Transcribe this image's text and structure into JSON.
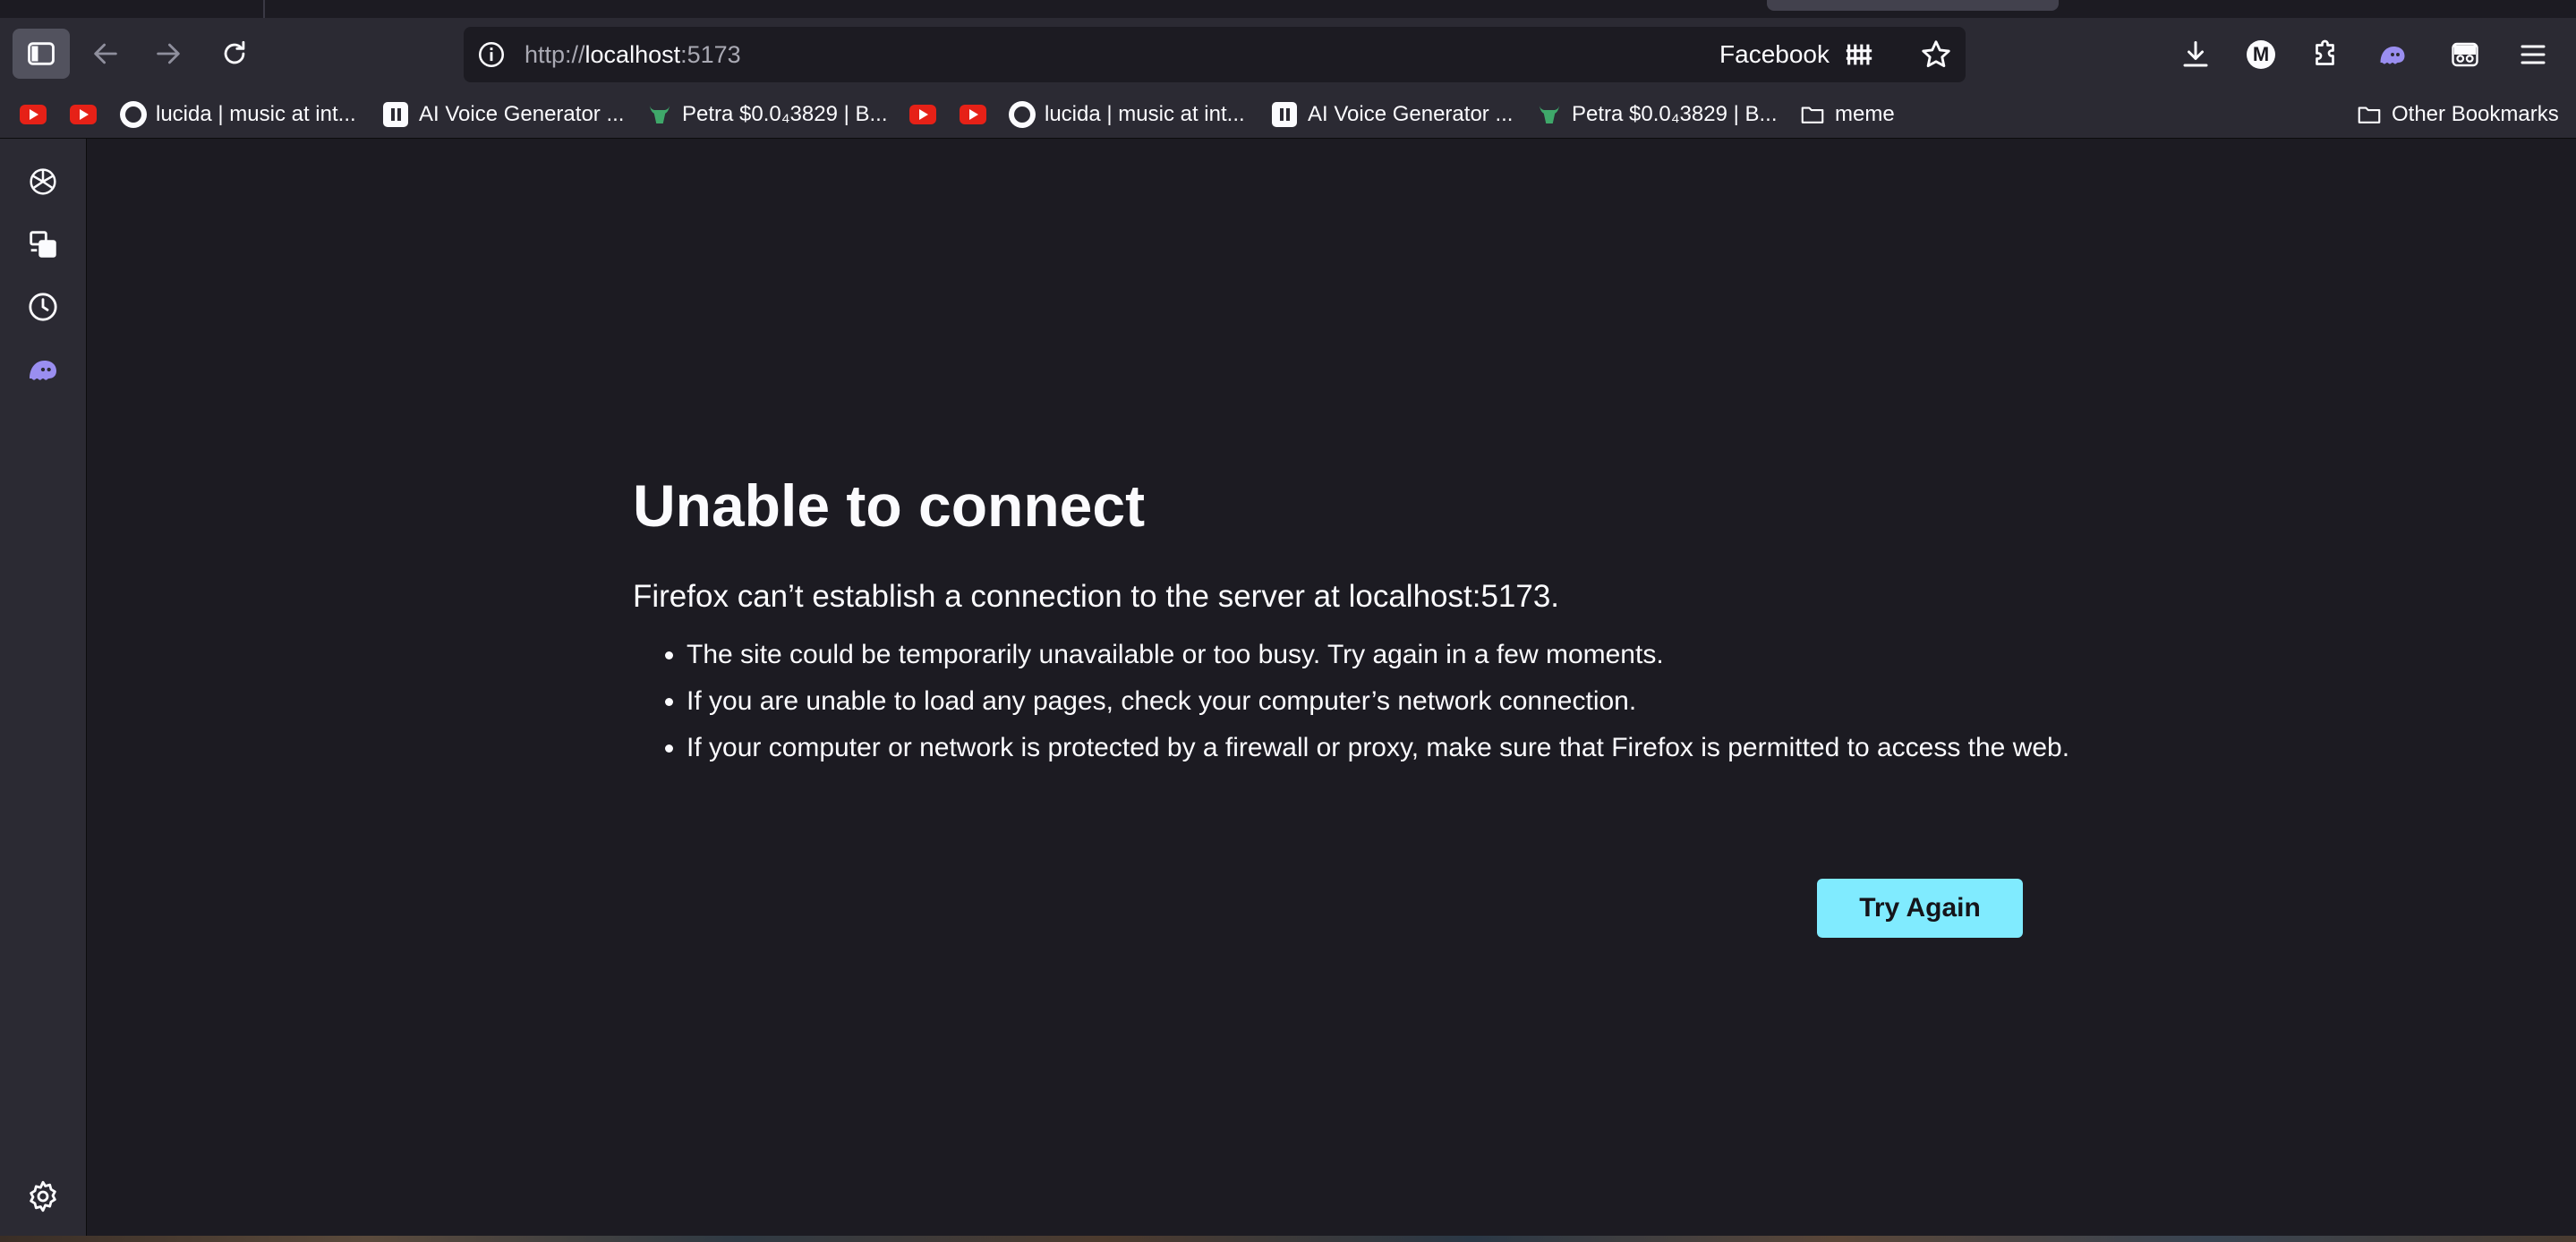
{
  "browser": {
    "url_prefix": "http://",
    "url_host": "localhost",
    "url_port": ":5173",
    "facebook_label": "Facebook",
    "profile_initial": "M"
  },
  "bookmarks": {
    "items": [
      {
        "label": "",
        "icon": "youtube-icon"
      },
      {
        "label": "",
        "icon": "youtube-icon"
      },
      {
        "label": "lucida | music at int...",
        "icon": "lucida-icon"
      },
      {
        "label": "AI Voice Generator ...",
        "icon": "ai-voice-icon"
      },
      {
        "label": "Petra $0.0₄3829 | B...",
        "icon": "petra-bull-icon"
      },
      {
        "label": "",
        "icon": "youtube-icon"
      },
      {
        "label": "",
        "icon": "youtube-icon"
      },
      {
        "label": "lucida | music at int...",
        "icon": "lucida-icon"
      },
      {
        "label": "AI Voice Generator ...",
        "icon": "ai-voice-icon"
      },
      {
        "label": "Petra $0.0₄3829 | B...",
        "icon": "petra-bull-icon"
      },
      {
        "label": "meme",
        "icon": "folder-icon"
      }
    ],
    "other_label": "Other Bookmarks"
  },
  "error_page": {
    "title": "Unable to connect",
    "description": "Firefox can’t establish a connection to the server at localhost:5173.",
    "bullets": [
      "The site could be temporarily unavailable or too busy. Try again in a few moments.",
      "If you are unable to load any pages, check your computer’s network connection.",
      "If your computer or network is protected by a firewall or proxy, make sure that Firefox is permitted to access the web."
    ],
    "try_again_label": "Try Again"
  },
  "colors": {
    "background": "#1c1b22",
    "toolbar": "#2b2a33",
    "button_accent": "#80ebff",
    "ghost_accent": "#9a8ef0"
  }
}
